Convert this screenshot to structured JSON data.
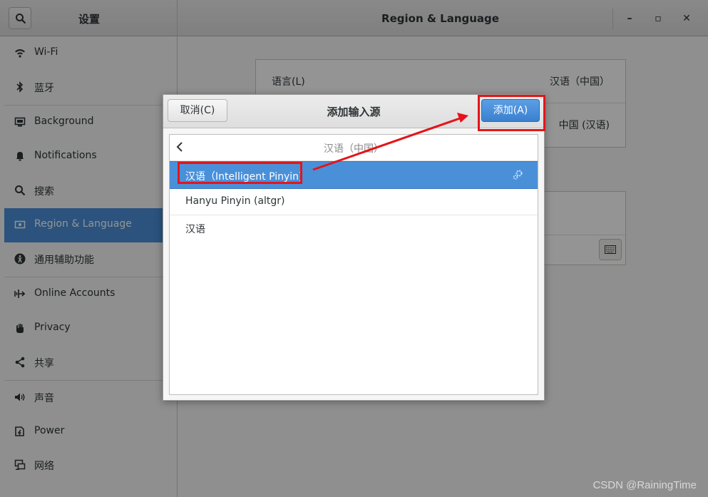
{
  "header": {
    "sidebar_title": "设置",
    "main_title": "Region & Language",
    "minimize_glyph": "–",
    "maximize_glyph": "▫",
    "close_glyph": "✕"
  },
  "sidebar": {
    "items": [
      {
        "label": "Wi-Fi",
        "icon": "wifi-icon"
      },
      {
        "label": "蓝牙",
        "icon": "bluetooth-icon"
      },
      {
        "label": "Background",
        "icon": "background-icon"
      },
      {
        "label": "Notifications",
        "icon": "bell-icon"
      },
      {
        "label": "搜索",
        "icon": "search-icon"
      },
      {
        "label": "Region & Language",
        "icon": "region-icon",
        "active": true
      },
      {
        "label": "通用辅助功能",
        "icon": "accessibility-icon"
      },
      {
        "label": "Online Accounts",
        "icon": "online-accounts-icon"
      },
      {
        "label": "Privacy",
        "icon": "hand-icon"
      },
      {
        "label": "共享",
        "icon": "share-icon"
      },
      {
        "label": "声音",
        "icon": "speaker-icon"
      },
      {
        "label": "Power",
        "icon": "power-icon"
      },
      {
        "label": "网络",
        "icon": "network-icon"
      }
    ]
  },
  "main": {
    "language_label": "语言(L)",
    "language_value": "汉语（中国）",
    "formats_value": "中国 (汉语)"
  },
  "dialog": {
    "cancel_label": "取消(C)",
    "title": "添加输入源",
    "add_label": "添加(A)",
    "list_title": "汉语（中国）",
    "rows": [
      {
        "label": "汉语（Intelligent Pinyin)",
        "selected": true
      },
      {
        "label": "Hanyu Pinyin (altgr)"
      },
      {
        "label": "汉语"
      }
    ]
  },
  "watermark": "CSDN @RainingTime",
  "colors": {
    "accent": "#4a90d9",
    "annotation": "#e3151a"
  }
}
